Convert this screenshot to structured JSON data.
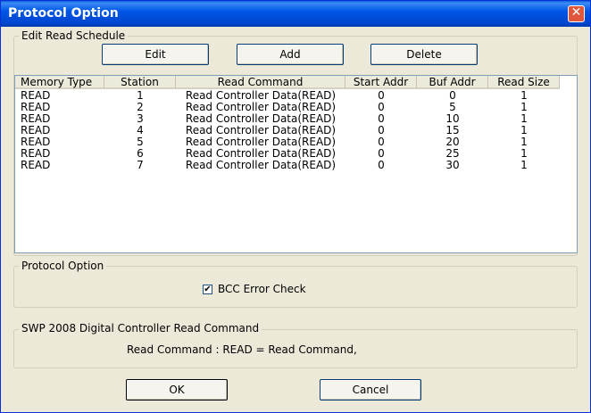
{
  "window": {
    "title": "Protocol Option"
  },
  "schedule": {
    "legend": "Edit Read Schedule",
    "buttons": {
      "edit": "Edit",
      "add": "Add",
      "delete": "Delete"
    },
    "columns": [
      "Memory Type",
      "Station",
      "Read Command",
      "Start Addr",
      "Buf Addr",
      "Read Size"
    ],
    "rows": [
      [
        "READ",
        "1",
        "Read Controller Data(READ)",
        "0",
        "0",
        "1"
      ],
      [
        "READ",
        "2",
        "Read Controller Data(READ)",
        "0",
        "5",
        "1"
      ],
      [
        "READ",
        "3",
        "Read Controller Data(READ)",
        "0",
        "10",
        "1"
      ],
      [
        "READ",
        "4",
        "Read Controller Data(READ)",
        "0",
        "15",
        "1"
      ],
      [
        "READ",
        "5",
        "Read Controller Data(READ)",
        "0",
        "20",
        "1"
      ],
      [
        "READ",
        "6",
        "Read Controller Data(READ)",
        "0",
        "25",
        "1"
      ],
      [
        "READ",
        "7",
        "Read Controller Data(READ)",
        "0",
        "30",
        "1"
      ]
    ]
  },
  "protocol": {
    "legend": "Protocol Option",
    "bcc_label": "BCC Error Check",
    "bcc_checked": true,
    "check_mark": "✔"
  },
  "info": {
    "legend": "SWP 2008 Digital Controller Read Command",
    "text": "Read Command : READ = Read Command,"
  },
  "footer": {
    "ok": "OK",
    "cancel": "Cancel"
  },
  "icons": {
    "close": "close-icon"
  }
}
